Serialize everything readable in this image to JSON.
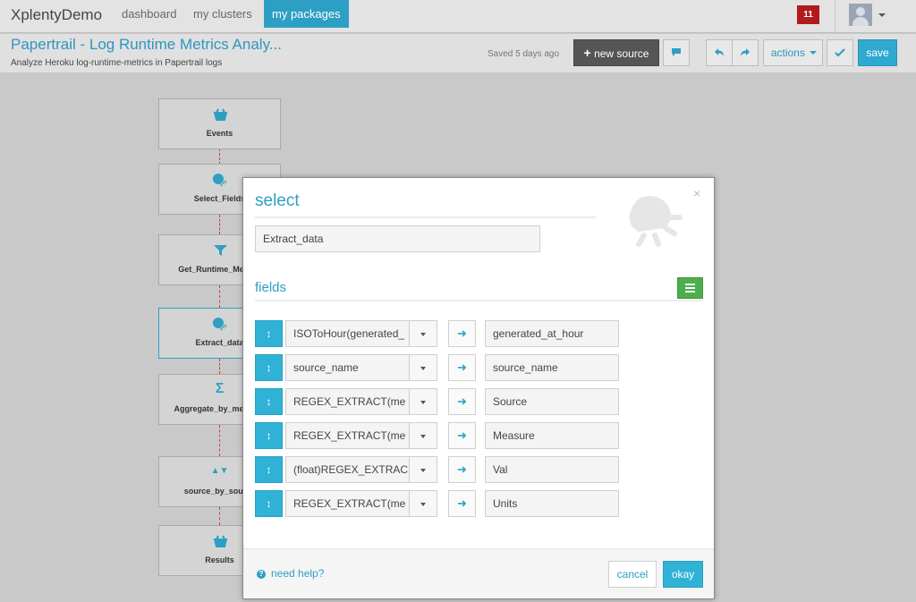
{
  "nav": {
    "brand": "XplentyDemo",
    "links": [
      {
        "label": "dashboard",
        "active": false
      },
      {
        "label": "my clusters",
        "active": false
      },
      {
        "label": "my packages",
        "active": true
      }
    ],
    "notification_count": "11",
    "avatar_icon": "user-avatar"
  },
  "package": {
    "title": "Papertrail - Log Runtime Metrics Analy...",
    "subtitle": "Analyze Heroku log-runtime-metrics in Papertrail logs",
    "saved_status": "Saved 5 days ago",
    "toolbar": {
      "new_source_label": "new source",
      "actions_label": "actions",
      "save_label": "save"
    }
  },
  "canvas": {
    "nodes": [
      {
        "label": "Events",
        "icon": "source-basket-icon"
      },
      {
        "label": "Select_Fields",
        "icon": "select-icon"
      },
      {
        "label": "Get_Runtime_Metrics",
        "icon": "filter-icon"
      },
      {
        "label": "Extract_data",
        "icon": "select-icon",
        "selected": true
      },
      {
        "label": "Aggregate_by_measure",
        "icon": "sigma-icon"
      },
      {
        "label": "source_by_source",
        "icon": "sort-icon"
      },
      {
        "label": "Results",
        "icon": "destination-basket-icon"
      }
    ]
  },
  "modal": {
    "title": "select",
    "component_name": "Extract_data",
    "fields_title": "fields",
    "fields": [
      {
        "expression": "ISOToHour(generated_",
        "alias": "generated_at_hour"
      },
      {
        "expression": "source_name",
        "alias": "source_name"
      },
      {
        "expression": "REGEX_EXTRACT(me",
        "alias": "Source"
      },
      {
        "expression": "REGEX_EXTRACT(me",
        "alias": "Measure"
      },
      {
        "expression": "(float)REGEX_EXTRAC",
        "alias": "Val"
      },
      {
        "expression": "REGEX_EXTRACT(me",
        "alias": "Units"
      }
    ],
    "help_label": "need help?",
    "cancel_label": "cancel",
    "okay_label": "okay"
  },
  "colors": {
    "accent": "#2e9fc4",
    "notification": "#b01c1c",
    "list_button": "#4cae4c",
    "connector": "#d23b3b"
  }
}
